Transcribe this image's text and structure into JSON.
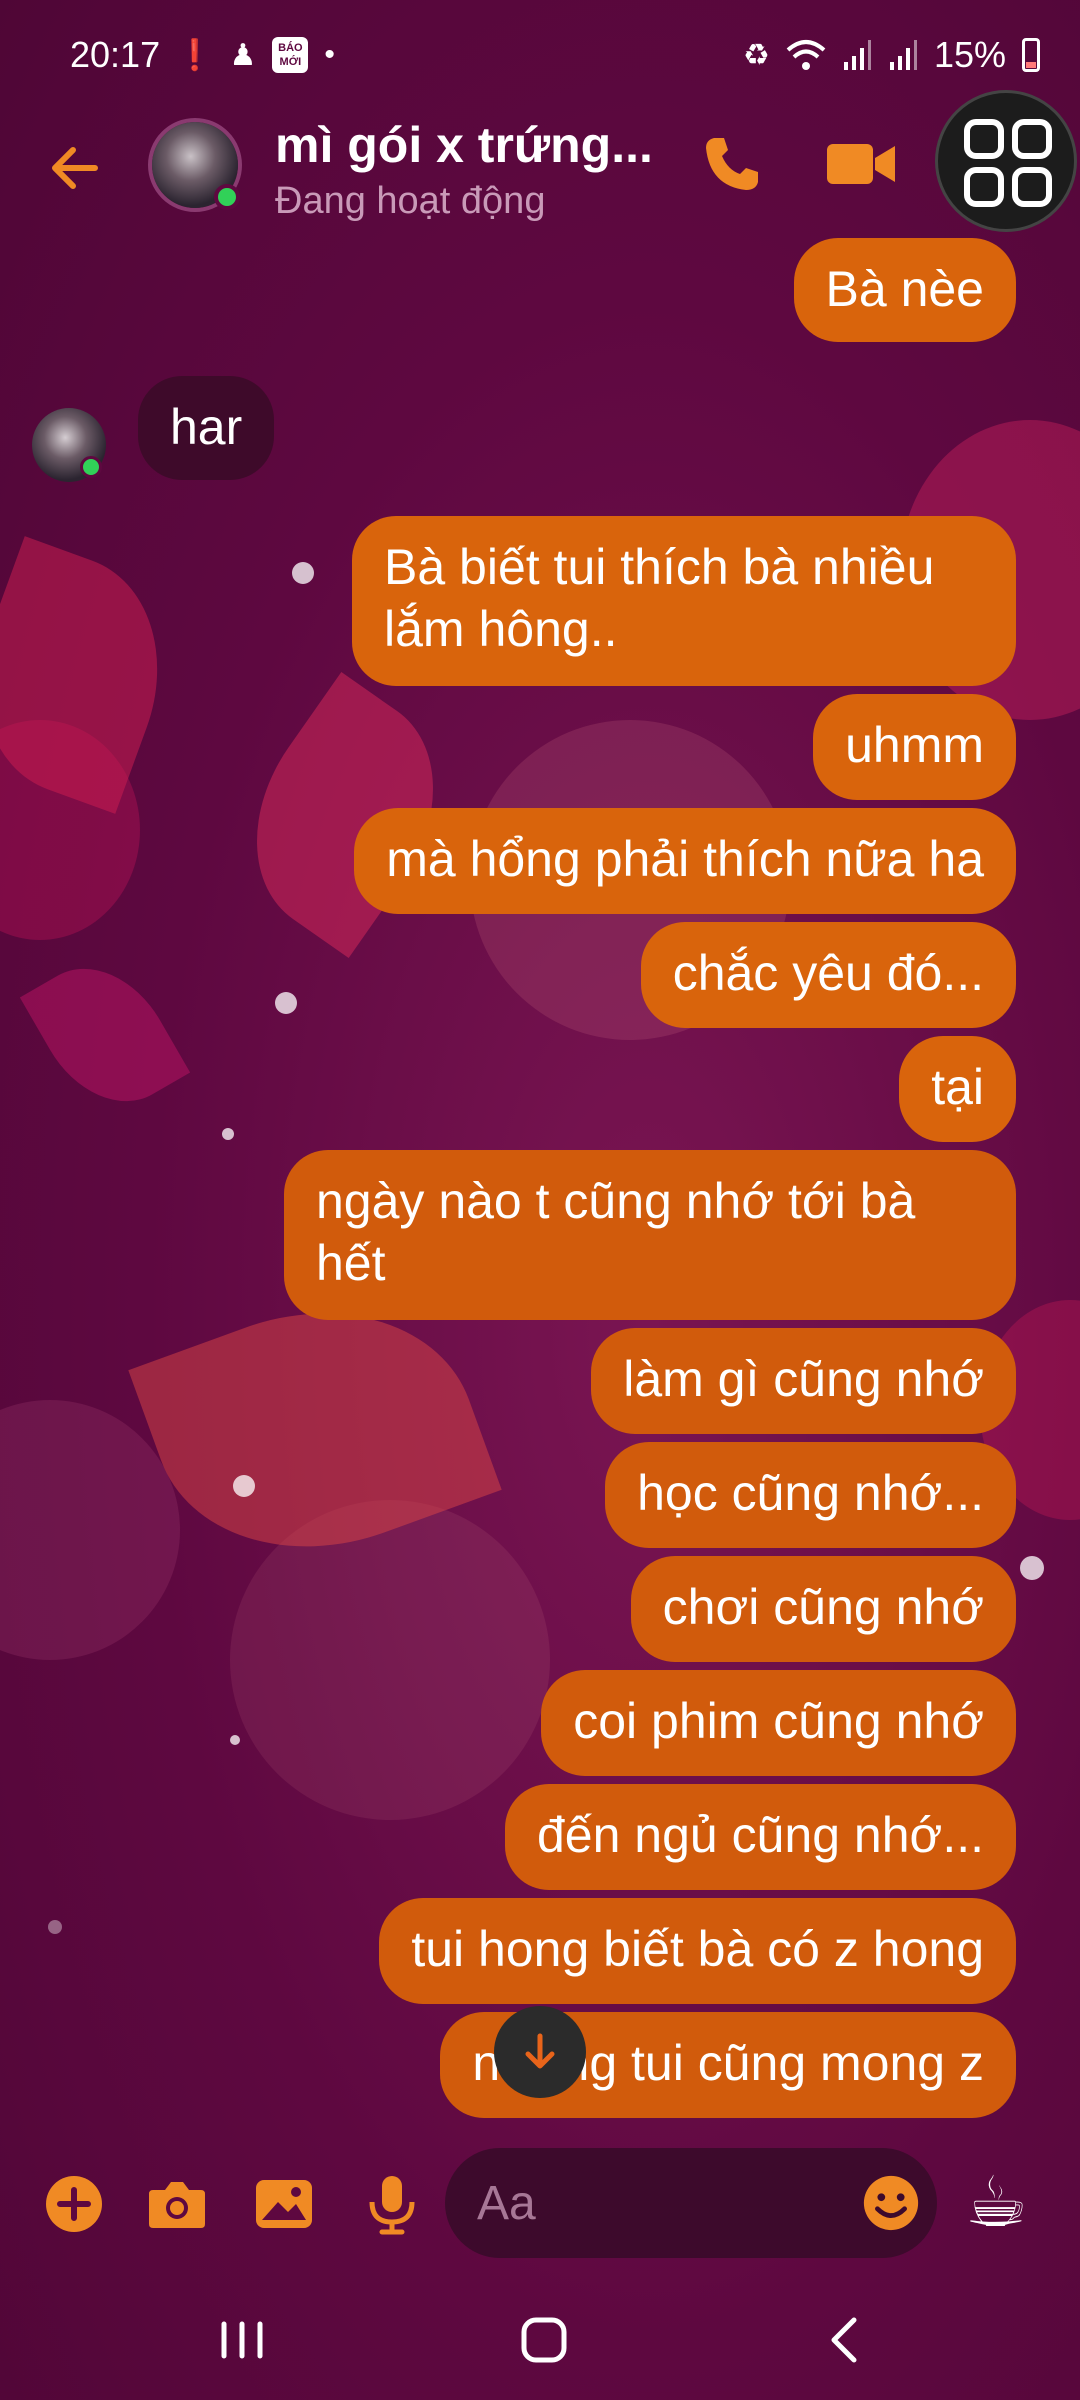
{
  "status_bar": {
    "time": "20:17",
    "news_badge": "BÁO MỚI",
    "battery_percent": "15%"
  },
  "header": {
    "contact_name": "mì gói x trứng...",
    "status": "Đang hoạt động"
  },
  "messages": [
    {
      "direction": "outgoing",
      "text": "Bà nèe"
    },
    {
      "direction": "incoming",
      "text": "har"
    },
    {
      "direction": "outgoing",
      "line1": "Bà biết tui thích bà nhiều",
      "line2": "lắm hông.."
    },
    {
      "direction": "outgoing",
      "text": "uhmm"
    },
    {
      "direction": "outgoing",
      "text": "mà hổng phải thích nữa ha"
    },
    {
      "direction": "outgoing",
      "text": "chắc yêu đó..."
    },
    {
      "direction": "outgoing",
      "text": "tại"
    },
    {
      "direction": "outgoing",
      "line1": "ngày nào t cũng nhớ tới bà",
      "line2": "hết"
    },
    {
      "direction": "outgoing",
      "text": "làm gì cũng nhớ"
    },
    {
      "direction": "outgoing",
      "text": "học cũng nhớ..."
    },
    {
      "direction": "outgoing",
      "text": "chơi cũng nhớ"
    },
    {
      "direction": "outgoing",
      "text": "coi phim cũng nhớ"
    },
    {
      "direction": "outgoing",
      "text": "đến ngủ cũng nhớ..."
    },
    {
      "direction": "outgoing",
      "text": "tui hong biết bà có z hong"
    },
    {
      "direction": "outgoing",
      "text": "nhưng tui cũng mong z"
    }
  ],
  "composer": {
    "placeholder": "Aa",
    "like_emoji": "☕"
  },
  "colors": {
    "background": "#5e0840",
    "accent": "#f08a24",
    "outgoing_bubble": "#d9640c",
    "incoming_bubble": "#3e0a2a",
    "online": "#31d158"
  },
  "icons": [
    "back-arrow-icon",
    "phone-icon",
    "video-camera-icon",
    "app-grid-icon",
    "plus-icon",
    "camera-icon",
    "image-icon",
    "microphone-icon",
    "emoji-icon",
    "coffee-icon",
    "arrow-down-icon",
    "recents-icon",
    "home-icon",
    "back-icon"
  ]
}
